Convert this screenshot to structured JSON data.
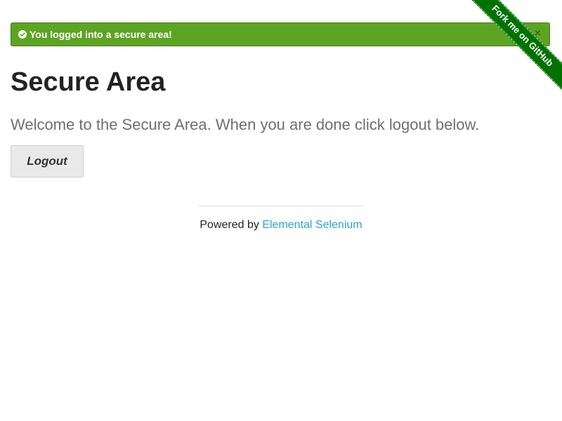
{
  "flash": {
    "message": "You logged into a secure area!",
    "close_symbol": "×",
    "icon": "check-circle-icon",
    "color": "#5da423"
  },
  "heading": "Secure Area",
  "subheader": "Welcome to the Secure Area. When you are done click logout below.",
  "logout_button": {
    "label": "Logout",
    "icon": "sign-out-icon"
  },
  "footer": {
    "prefix": "Powered by ",
    "link_text": "Elemental Selenium",
    "link_color": "#2ba6cb"
  },
  "ribbon": {
    "text": "Fork me on GitHub",
    "color": "#007200"
  }
}
